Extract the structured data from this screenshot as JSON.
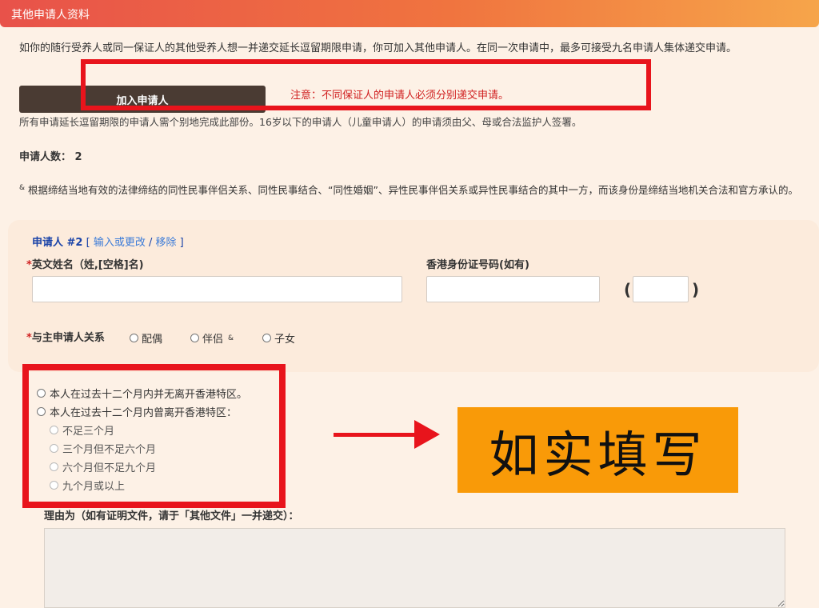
{
  "header": {
    "title": "其他申请人资料"
  },
  "intro": {
    "text": "如你的随行受养人或同一保证人的其他受养人想一并递交延长逗留期限申请，你可加入其他申请人。在同一次申请中，最多可接受九名申请人集体递交申请。"
  },
  "add_button": {
    "label": "加入申请人"
  },
  "notice": {
    "text": "注意：不同保证人的申请人必须分别递交申请。"
  },
  "signature_note": {
    "text": "所有申请延长逗留期限的申请人需个别地完成此部份。16岁以下的申请人（儿童申请人）的申请须由父、母或合法监护人签署。"
  },
  "applicant_count": {
    "label": "申请人数：",
    "value": "2"
  },
  "amp_note": {
    "mark": "&",
    "text": "根据缔结当地有效的法律缔结的同性民事伴侣关系、同性民事结合、“同性婚姻”、异性民事伴侣关系或异性民事结合的其中一方，而该身份是缔结当地机关合法和官方承认的。"
  },
  "applicant": {
    "title": "申请人 #2",
    "bracket_open": "[",
    "edit_link": "输入或更改",
    "separator": "/",
    "remove_link": "移除",
    "bracket_close": "]"
  },
  "fields": {
    "required_mark": "*",
    "english_name_label": "英文姓名（姓,[空格]名)",
    "english_name_value": "",
    "hkid_label": "香港身份证号码(如有)",
    "hkid_value": "",
    "check_digit_value": "",
    "paren_open": "(",
    "paren_close": ")"
  },
  "relationship": {
    "label": "与主申请人关系",
    "options": [
      "配偶",
      "伴侣",
      "子女"
    ],
    "amp": "&"
  },
  "stay": {
    "option_not_left": "本人在过去十二个月内并无离开香港特区。",
    "option_left": "本人在过去十二个月内曾离开香港特区：",
    "durations": [
      "不足三个月",
      "三个月但不足六个月",
      "六个月但不足九个月",
      "九个月或以上"
    ]
  },
  "banner": {
    "text": "如实填写"
  },
  "reason": {
    "label": "理由为（如有证明文件，请于「其他文件」一并递交）：",
    "value": ""
  },
  "colors": {
    "annotation_red": "#e8141c",
    "banner_orange": "#f99a08",
    "button_brown": "#4a3b33"
  }
}
